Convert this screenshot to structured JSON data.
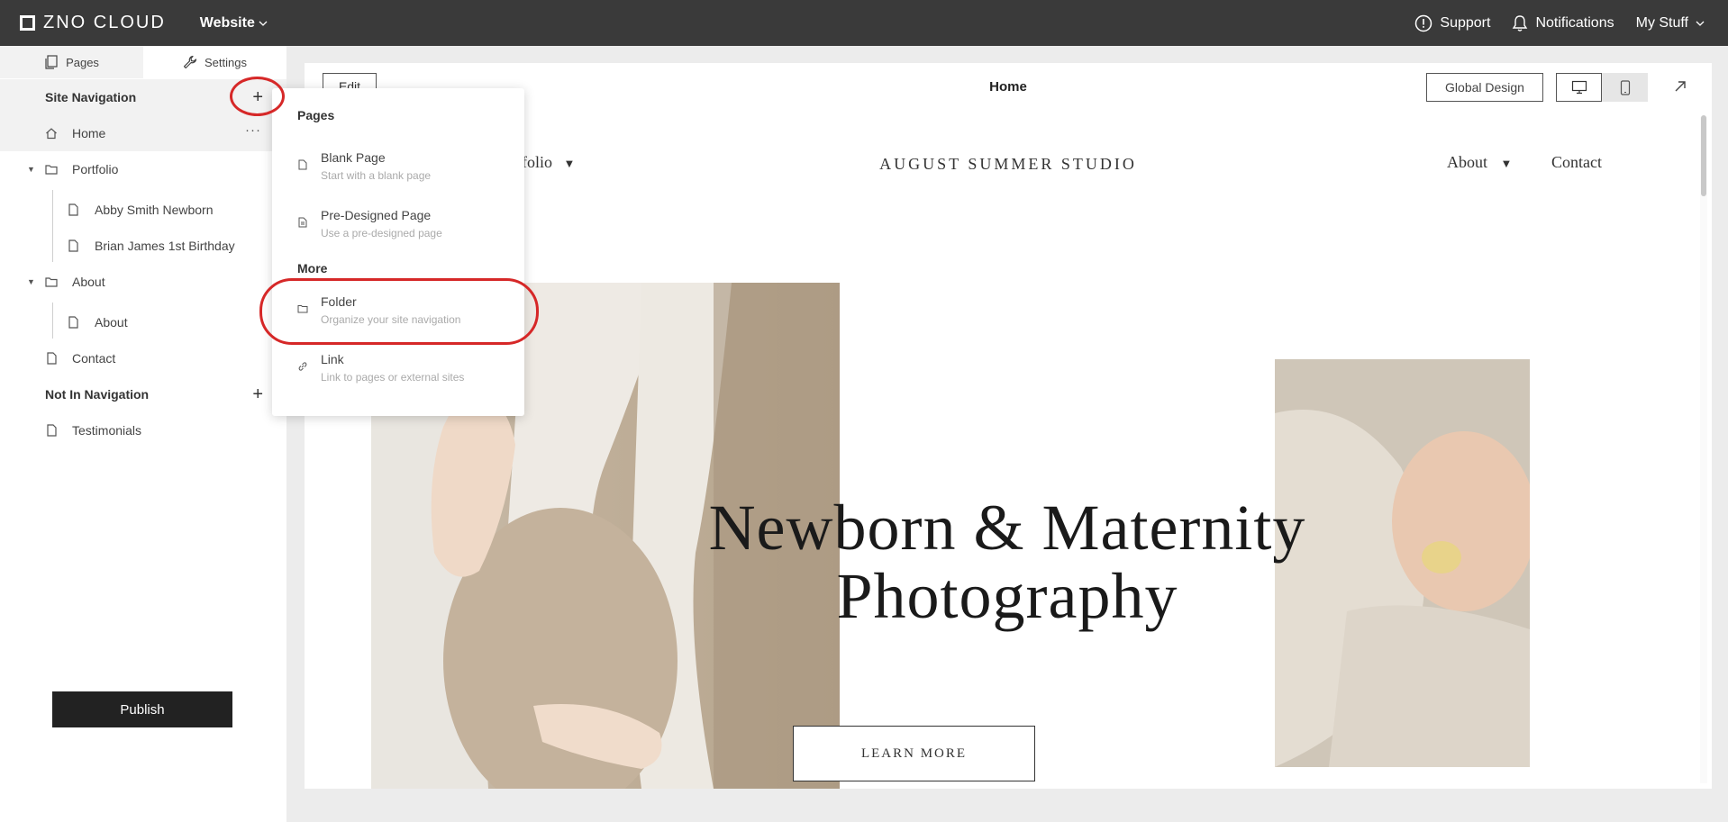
{
  "topbar": {
    "logo_text": "ZNO CLOUD",
    "site_menu": "Website",
    "support": "Support",
    "notifications": "Notifications",
    "my_stuff": "My Stuff"
  },
  "sidebar": {
    "tabs": [
      {
        "label": "Pages",
        "active": true
      },
      {
        "label": "Settings",
        "active": false
      }
    ],
    "site_navigation_label": "Site Navigation",
    "not_in_navigation_label": "Not In Navigation",
    "items": {
      "home": "Home",
      "portfolio": "Portfolio",
      "abby": "Abby Smith Newborn",
      "brian": "Brian James 1st Birthday",
      "about_folder": "About",
      "about_page": "About",
      "contact": "Contact",
      "testimonials": "Testimonials"
    },
    "home_more": "···",
    "publish": "Publish"
  },
  "canvas": {
    "edit": "Edit",
    "page_title": "Home",
    "global_design": "Global Design",
    "site_nav": {
      "portfolio": "rtfolio",
      "about": "About",
      "contact": "Contact"
    },
    "brand": "AUGUST SUMMER STUDIO",
    "hero_line1": "Newborn & Maternity",
    "hero_line2": "Photography",
    "learn_more": "LEARN MORE"
  },
  "dropdown": {
    "pages_heading": "Pages",
    "more_heading": "More",
    "items": [
      {
        "title": "Blank Page",
        "subtitle": "Start with a blank page"
      },
      {
        "title": "Pre-Designed Page",
        "subtitle": "Use a pre-designed page"
      },
      {
        "title": "Folder",
        "subtitle": "Organize your site navigation"
      },
      {
        "title": "Link",
        "subtitle": "Link to pages or external sites"
      }
    ]
  },
  "colors": {
    "topbar": "#3a3a3a",
    "annotation_red": "#d62828",
    "publish_bg": "#222222"
  }
}
